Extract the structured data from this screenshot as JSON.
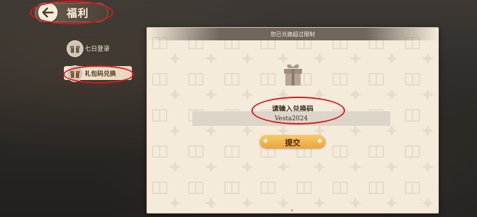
{
  "header": {
    "title": "福利"
  },
  "sidebar": {
    "items": [
      {
        "label": "七日登录",
        "active": false
      },
      {
        "label": "礼包码兑换",
        "active": true
      }
    ]
  },
  "panel": {
    "notice": "您已兑换超过限制",
    "prompt": "请输入兑换码",
    "code_value": "Vesta2024",
    "submit_label": "提交"
  },
  "colors": {
    "annotation": "#e0161b",
    "button": "#eca43e",
    "panel_bg": "#f4ebdb"
  }
}
